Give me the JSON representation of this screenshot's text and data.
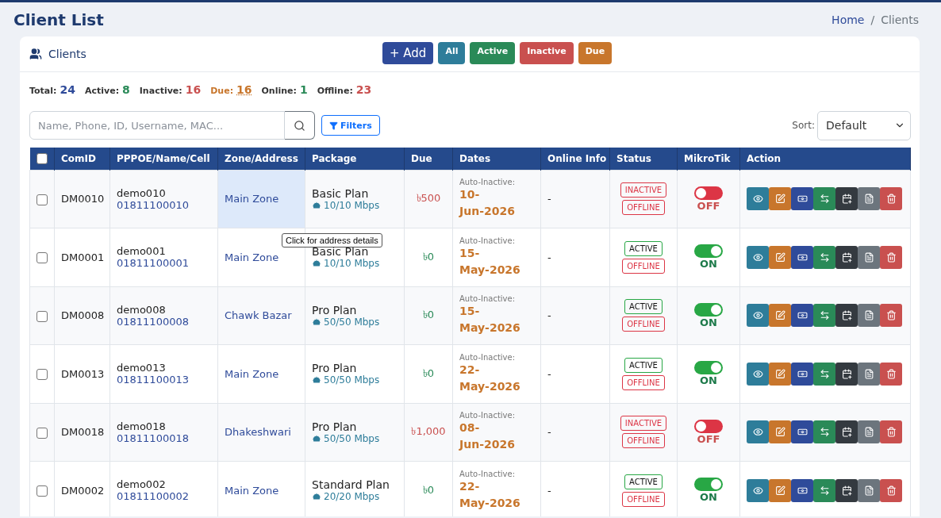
{
  "page": {
    "title": "Client List"
  },
  "breadcrumb": [
    {
      "label": "Home",
      "link": true
    },
    {
      "label": "/",
      "link": false
    },
    {
      "label": "Clients",
      "link": false
    }
  ],
  "card": {
    "title": "Clients",
    "add_button": "+ Add",
    "filters": [
      {
        "label": "All",
        "color": "#2e7d9a"
      },
      {
        "label": "Active",
        "color": "#2a8a58"
      },
      {
        "label": "Inactive",
        "color": "#c9504f"
      },
      {
        "label": "Due",
        "color": "#c8762c"
      }
    ]
  },
  "stats": [
    {
      "label": "Total:",
      "value": "24",
      "color": "#2f4b9a",
      "highlight": false
    },
    {
      "label": "Active:",
      "value": "8",
      "color": "#2a8a58",
      "highlight": false
    },
    {
      "label": "Inactive:",
      "value": "16",
      "color": "#c9504f",
      "highlight": false
    },
    {
      "label": "Due:",
      "value": "16",
      "color": "#c8762c",
      "highlight": true
    },
    {
      "label": "Online:",
      "value": "1",
      "color": "#2a8a58",
      "highlight": false
    },
    {
      "label": "Offline:",
      "value": "23",
      "color": "#c9504f",
      "highlight": false
    }
  ],
  "search": {
    "placeholder": "Name, Phone, ID, Username, MAC..."
  },
  "filters_button": "Filters",
  "sort": {
    "label": "Sort:",
    "value": "Default"
  },
  "table": {
    "select_all": false,
    "columns": [
      "ComID",
      "PPPOE/Name/Cell",
      "Zone/Address",
      "Package",
      "Due",
      "Dates",
      "Online Info",
      "Status",
      "MikroTik",
      "Action"
    ],
    "rows": [
      {
        "checked": false,
        "id": "DM0010",
        "name": "demo010",
        "cell": "01811100010",
        "zone": "Main Zone",
        "zone_hovered": true,
        "zone_tooltip": "Click for address details",
        "package": "Basic Plan",
        "speed": "10/10 Mbps",
        "due": "৳500",
        "overdue": true,
        "date_label": "Auto-Inactive:",
        "date": "10-Jun-2026",
        "online_info": "-",
        "status": {
          "label": "INACTIVE",
          "active": false
        },
        "connection": {
          "label": "OFFLINE",
          "online": false
        },
        "mikrotik": {
          "label": "OFF",
          "on": false
        }
      },
      {
        "checked": false,
        "id": "DM0001",
        "name": "demo001",
        "cell": "01811100001",
        "zone": "Main Zone",
        "zone_hovered": false,
        "package": "Basic Plan",
        "speed": "10/10 Mbps",
        "due": "৳0",
        "overdue": false,
        "date_label": "Auto-Inactive:",
        "date": "15-May-2026",
        "online_info": "-",
        "status": {
          "label": "ACTIVE",
          "active": true
        },
        "connection": {
          "label": "OFFLINE",
          "online": false
        },
        "mikrotik": {
          "label": "ON",
          "on": true
        }
      },
      {
        "checked": false,
        "id": "DM0008",
        "name": "demo008",
        "cell": "01811100008",
        "zone": "Chawk Bazar",
        "zone_hovered": false,
        "package": "Pro Plan",
        "speed": "50/50 Mbps",
        "due": "৳0",
        "overdue": false,
        "date_label": "Auto-Inactive:",
        "date": "15-May-2026",
        "online_info": "-",
        "status": {
          "label": "ACTIVE",
          "active": true
        },
        "connection": {
          "label": "OFFLINE",
          "online": false
        },
        "mikrotik": {
          "label": "ON",
          "on": true
        }
      },
      {
        "checked": false,
        "id": "DM0013",
        "name": "demo013",
        "cell": "01811100013",
        "zone": "Main Zone",
        "zone_hovered": false,
        "package": "Pro Plan",
        "speed": "50/50 Mbps",
        "due": "৳0",
        "overdue": false,
        "date_label": "Auto-Inactive:",
        "date": "22-May-2026",
        "online_info": "-",
        "status": {
          "label": "ACTIVE",
          "active": true
        },
        "connection": {
          "label": "OFFLINE",
          "online": false
        },
        "mikrotik": {
          "label": "ON",
          "on": true
        }
      },
      {
        "checked": false,
        "id": "DM0018",
        "name": "demo018",
        "cell": "01811100018",
        "zone": "Dhakeshwari",
        "zone_hovered": false,
        "package": "Pro Plan",
        "speed": "50/50 Mbps",
        "due": "৳1,000",
        "overdue": true,
        "date_label": "Auto-Inactive:",
        "date": "08-Jun-2026",
        "online_info": "-",
        "status": {
          "label": "INACTIVE",
          "active": false
        },
        "connection": {
          "label": "OFFLINE",
          "online": false
        },
        "mikrotik": {
          "label": "OFF",
          "on": false
        }
      },
      {
        "checked": false,
        "id": "DM0002",
        "name": "demo002",
        "cell": "01811100002",
        "zone": "Main Zone",
        "zone_hovered": false,
        "package": "Standard Plan",
        "speed": "20/20 Mbps",
        "due": "৳0",
        "overdue": false,
        "date_label": "Auto-Inactive:",
        "date": "22-May-2026",
        "online_info": "-",
        "status": {
          "label": "ACTIVE",
          "active": true
        },
        "connection": {
          "label": "OFFLINE",
          "online": false
        },
        "mikrotik": {
          "label": "ON",
          "on": true
        }
      }
    ]
  }
}
